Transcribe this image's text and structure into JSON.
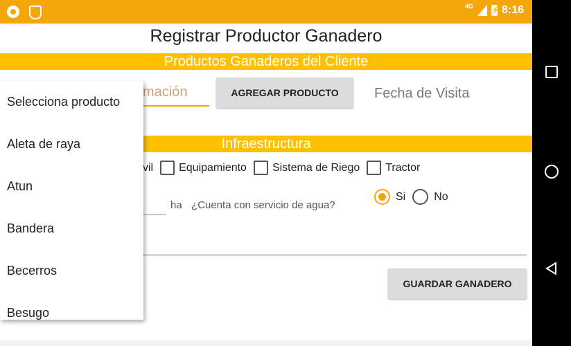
{
  "status_bar": {
    "network": "4G",
    "time": "8:16",
    "icons": [
      "chat-bubble-icon",
      "shield-icon",
      "signal-icon",
      "battery-charging-icon"
    ]
  },
  "header": {
    "title": "Registrar Productor Ganadero"
  },
  "sections": {
    "productos": "Productos Ganaderos del Cliente",
    "infraestructura": "Infraestructura"
  },
  "productos": {
    "estimacion_partial": "timación",
    "agregar_button": "AGREGAR PRODUCTO",
    "fecha_visita": "Fecha de Visita"
  },
  "infra": {
    "checkboxes": [
      {
        "label": "vil",
        "checked": false
      },
      {
        "label": "Equipamiento",
        "checked": false
      },
      {
        "label": "Sistema de Riego",
        "checked": false
      },
      {
        "label": "Tractor",
        "checked": false
      }
    ],
    "ha_unit": "ha",
    "agua_question": "¿Cuenta con servicio de agua?",
    "agua_options": [
      "Si",
      "No"
    ],
    "agua_selected": "Si"
  },
  "guardar_button": "GUARDAR GANADERO",
  "dropdown": {
    "items": [
      "Selecciona producto",
      "Aleta de raya",
      "Atun",
      "Bandera",
      "Becerros",
      "Besugo"
    ]
  },
  "colors": {
    "accent": "#ffc000",
    "status_bar": "#f4a70b",
    "radio_selected": "#f4a70b"
  }
}
